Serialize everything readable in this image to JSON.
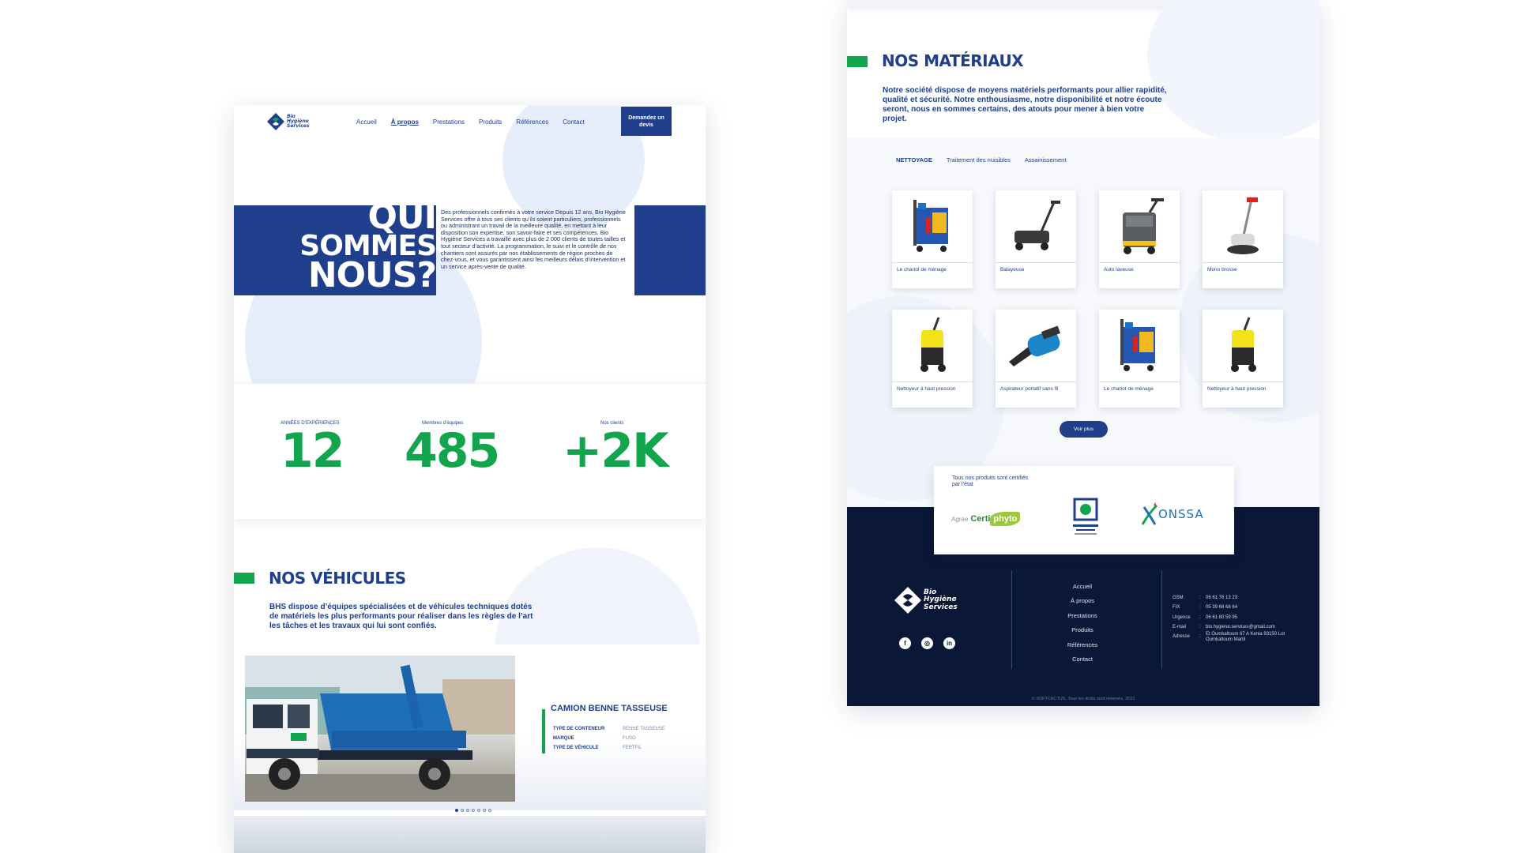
{
  "brand": {
    "name_line1": "Bio",
    "name_line2": "Hygiène",
    "name_line3": "Services"
  },
  "colors": {
    "primary": "#1f3e8c",
    "accent": "#12a54d",
    "footer": "#0b1736"
  },
  "nav": {
    "items": [
      "Accueil",
      "À propos",
      "Prestations",
      "Produits",
      "Références",
      "Contact"
    ],
    "active": "À propos",
    "cta": "Demandez un devis"
  },
  "hero": {
    "title_line1": "QUI",
    "title_line2": "SOMMES",
    "title_line3": "NOUS?",
    "text": "Des professionnels confirmés à votre service Depuis 12 ans, Bio Hygiène Services offre à tous ses clients qu’ils soient particuliers, professionnels ou administrant un travail de la meilleure qualité, en mettant à leur disposition son expertise, son savoir-faire et ses compétences. Bio Hygiène Services a travaillé avec plus de 2 000 clients de toutes tailles et tout secteur d’activité. La programmation, le suivi et le contrôle de nos chantiers sont assurés par nos établissements de région proches de chez-vous, et vous garantissent ainsi les meilleurs délais d’intervention et un service après-vente de qualité."
  },
  "stats": [
    {
      "label": "ANNÉES D’EXPÉRIENCES",
      "value": "12"
    },
    {
      "label": "Membres d’équipes",
      "value": "485"
    },
    {
      "label": "Nos clients",
      "value": "+2K"
    }
  ],
  "vehicles": {
    "title": "NOS VÉHICULES",
    "description": "BHS dispose d’équipes spécialisées et de véhicules techniques dotés de matériels les plus performants pour réaliser dans les règles de l’art les tâches et les travaux qui lui sont confiés.",
    "current": {
      "name": "CAMION BENNE TASSEUSE",
      "specs": [
        {
          "key": "TYPE DE CONTENEUR",
          "value": "BENNE TASSEUSE"
        },
        {
          "key": "MARQUE",
          "value": "FUSO"
        },
        {
          "key": "TYPE DE VÉHICULE",
          "value": "FERTFIL"
        }
      ]
    },
    "slides_total": 7,
    "slide_active": 1
  },
  "materials": {
    "title": "NOS MATÉRIAUX",
    "description": "Notre société dispose de moyens matériels performants pour allier rapidité, qualité et sécurité. Notre enthousiasme, notre disponibilité et notre écoute seront, nous en sommes certains, des atouts pour mener à bien votre projet.",
    "tabs": [
      "NETTOYAGE",
      "Traitement des nuisibles",
      "Assainissement"
    ],
    "active_tab": "NETTOYAGE",
    "products": [
      {
        "name": "Le chariot de ménage",
        "icon": "cart-icon"
      },
      {
        "name": "Balayeuse",
        "icon": "sweeper-icon"
      },
      {
        "name": "Auto laveuse",
        "icon": "scrubber-icon"
      },
      {
        "name": "Mono brosse",
        "icon": "floor-buffer-icon"
      },
      {
        "name": "Nettoyeur à haut pression",
        "icon": "pressure-washer-icon"
      },
      {
        "name": "Aspirateur portatif sans fil",
        "icon": "handheld-vacuum-icon"
      },
      {
        "name": "Le chariot de ménage",
        "icon": "cart-icon"
      },
      {
        "name": "Nettoyeur à haut pression",
        "icon": "pressure-washer-icon"
      }
    ],
    "more_button": "Voir plus"
  },
  "certifications": {
    "text": "Tous nos produits sont certifiés par l’état",
    "logos": [
      {
        "name": "certiphyto-logo",
        "text_a": "Agrée",
        "text_b": "Certi",
        "text_c": "phyto"
      },
      {
        "name": "ministry-health-logo"
      },
      {
        "name": "onssa-logo",
        "text": "ONSSA"
      }
    ]
  },
  "footer": {
    "menu": [
      "Accueil",
      "À propos",
      "Prestations",
      "Produits",
      "Références",
      "Contact"
    ],
    "contact": [
      {
        "key": "GSM",
        "value": "06 61 76 13 23"
      },
      {
        "key": "FIX",
        "value": "05 39 68 68 64"
      },
      {
        "key": "Urgence",
        "value": "06 61 80 59 95"
      },
      {
        "key": "E-mail",
        "value": "bio.hygiene.services@gmail.com"
      },
      {
        "key": "Adresse",
        "value": "Et Oumkaltoum 67 A Kenia 93150 Lot Oumkaltoum  Martil"
      }
    ],
    "socials": [
      "facebook-icon",
      "instagram-icon",
      "linkedin-icon"
    ],
    "copyright": "© SOFTCACTUS, Tous les droits sont réservés, 2022"
  }
}
